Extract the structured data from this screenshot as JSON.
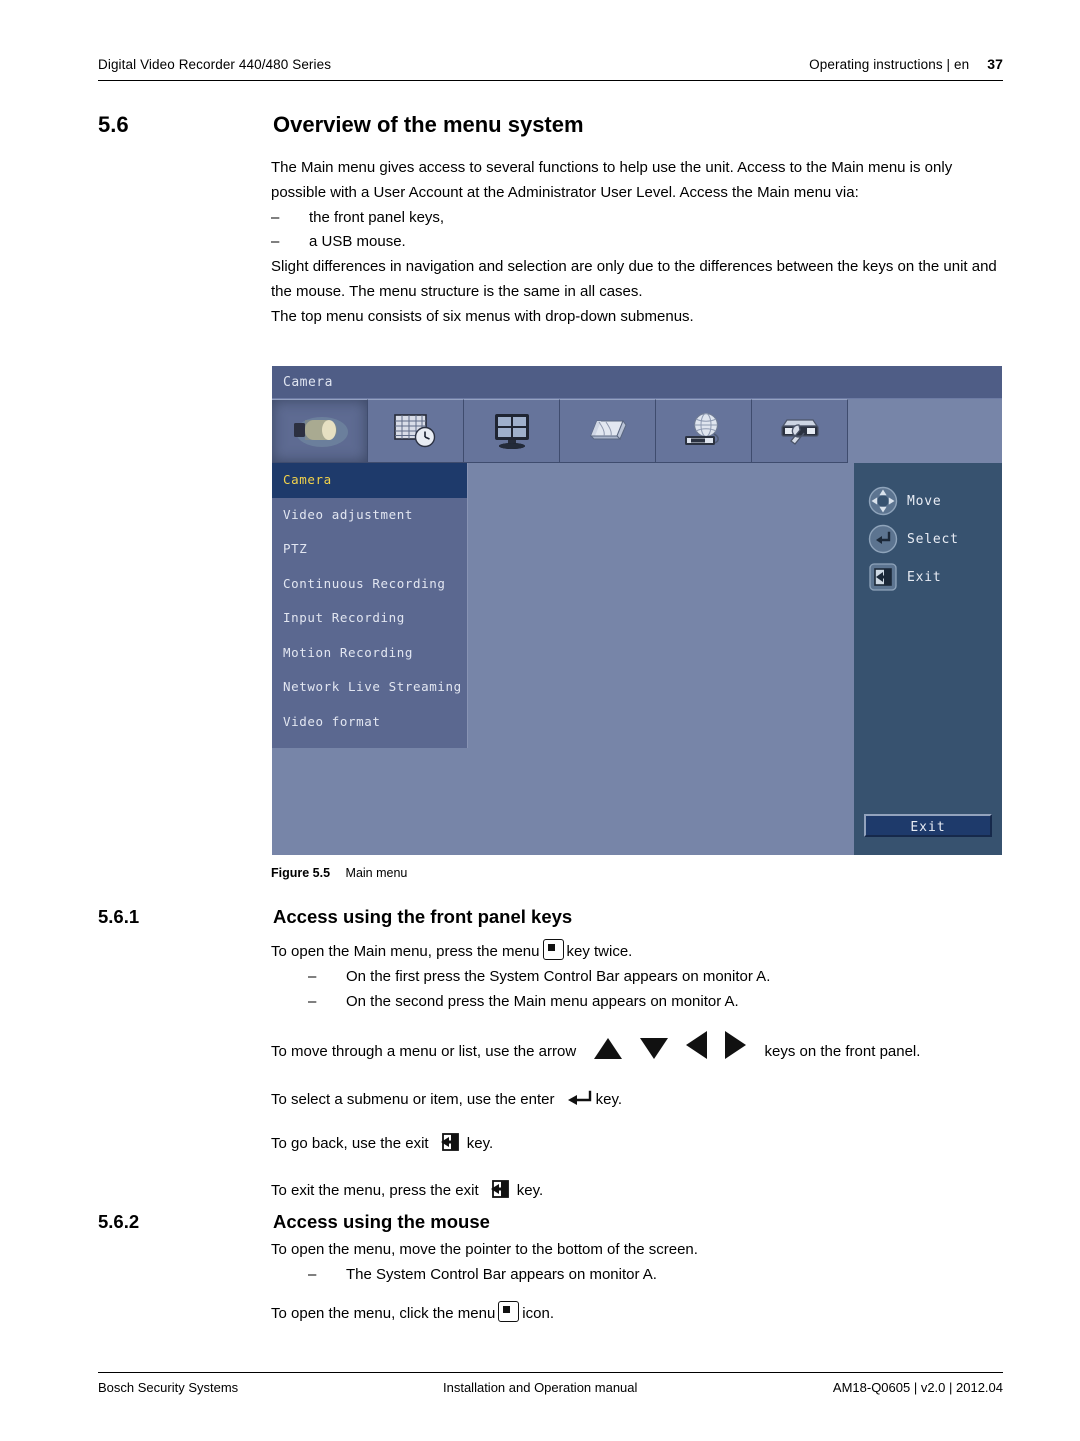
{
  "header": {
    "left": "Digital Video Recorder 440/480 Series",
    "right": "Operating instructions | en",
    "page_number": "37"
  },
  "section": {
    "number": "5.6",
    "title": "Overview of the menu system",
    "paragraphs": [
      "The Main menu gives access to several functions to help use the unit. Access to the Main menu is only possible with a User Account at the Administrator User Level. Access the Main menu via:"
    ],
    "bullets": [
      {
        "dash": "–",
        "text": "the front panel keys,"
      },
      {
        "dash": "–",
        "text": "a USB mouse."
      }
    ],
    "paragraph2": "Slight differences in navigation and selection are only due to the differences between the keys on the unit and the mouse. The menu structure is the same in all cases.",
    "paragraph3": "The top menu consists of six menus with drop-down submenus."
  },
  "figure": {
    "caption_label": "Figure 5.5",
    "caption_text": "Main menu",
    "dvr": {
      "title": "Camera",
      "toolbar_icons": [
        {
          "name": "camera-icon",
          "selected": true
        },
        {
          "name": "schedule-clock-icon",
          "selected": false
        },
        {
          "name": "display-monitor-icon",
          "selected": false
        },
        {
          "name": "storage-disks-icon",
          "selected": false
        },
        {
          "name": "network-globe-icon",
          "selected": false
        },
        {
          "name": "system-wrench-icon",
          "selected": false
        }
      ],
      "menu_items": [
        {
          "label": "Camera",
          "active": true
        },
        {
          "label": "Video adjustment",
          "active": false
        },
        {
          "label": "PTZ",
          "active": false
        },
        {
          "label": "Continuous Recording",
          "active": false
        },
        {
          "label": "Input Recording",
          "active": false
        },
        {
          "label": "Motion Recording",
          "active": false
        },
        {
          "label": "Network Live Streaming",
          "active": false
        },
        {
          "label": "Video format",
          "active": false
        }
      ],
      "hints": [
        {
          "icon": "dpad-icon",
          "label": "Move"
        },
        {
          "icon": "enter-icon",
          "label": "Select"
        },
        {
          "icon": "exit-icon",
          "label": "Exit"
        }
      ],
      "exit_button": "Exit",
      "colors": {
        "titlebar": "#4f5d86",
        "toolbar": "#66749b",
        "sidebar": "#5b6890",
        "content": "#7785a8",
        "right_panel": "#37526f",
        "highlight_bg": "#1e3a6b",
        "highlight_text": "#f2d24b"
      }
    }
  },
  "subsection1": {
    "number": "5.6.1",
    "title": "Access using the front panel keys",
    "line1_a": "To open the Main menu, press the menu",
    "line1_b": "key twice.",
    "bullets": [
      {
        "dash": "–",
        "text": "On the first press the System Control Bar appears on monitor A."
      },
      {
        "dash": "–",
        "text": "On the second press the Main menu appears on monitor A."
      }
    ],
    "line2_a": "To move through a menu or list, use the arrow",
    "line2_b": "keys on the front panel.",
    "line3_a": "To select a submenu or item, use the enter",
    "line3_b": "key.",
    "line4_a": "To go back, use the exit",
    "line4_b": "key.",
    "line5_a": "To exit the menu, press the exit",
    "line5_b": "key."
  },
  "subsection2": {
    "number": "5.6.2",
    "title": "Access using the mouse",
    "line1": "To open the menu, move the pointer to the bottom of the screen.",
    "bullets": [
      {
        "dash": "–",
        "text": "The System Control Bar appears on monitor A."
      }
    ],
    "line2_a": "To open the menu, click the menu",
    "line2_b": "icon."
  },
  "footer": {
    "left": "Bosch Security Systems",
    "center": "Installation and Operation manual",
    "right": "AM18-Q0605 | v2.0 | 2012.04"
  }
}
